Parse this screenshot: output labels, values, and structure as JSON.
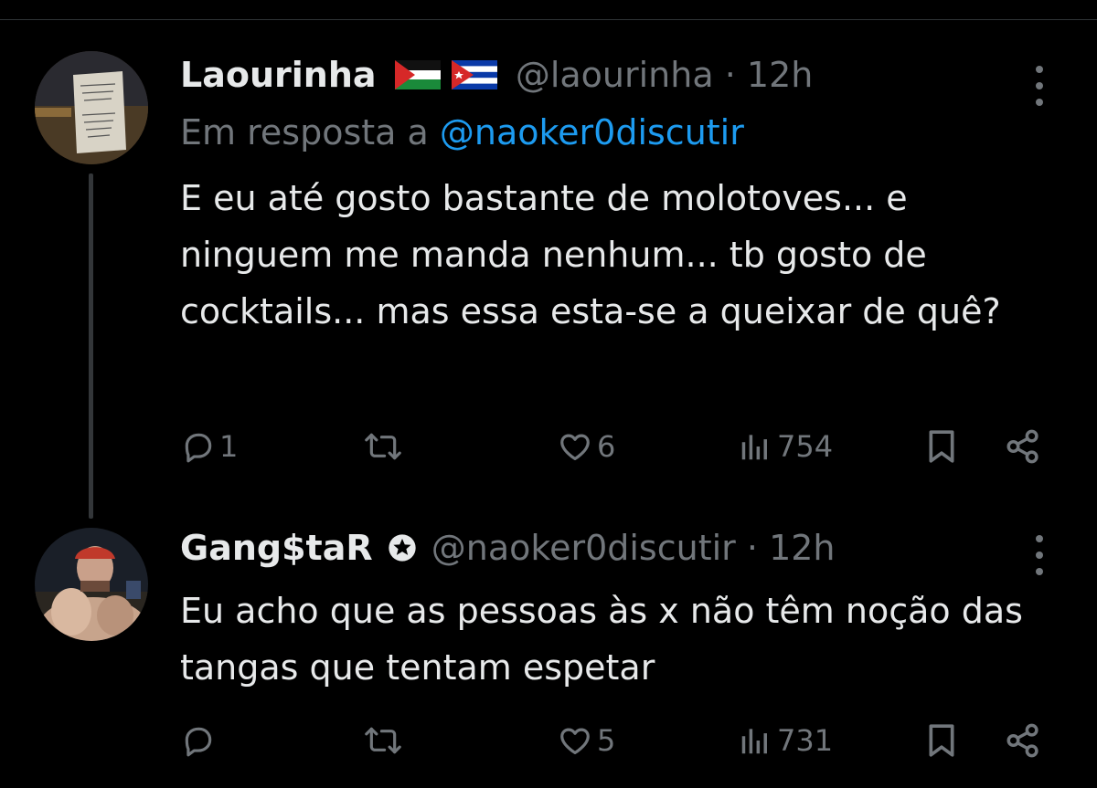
{
  "colors": {
    "background": "#000000",
    "text": "#e7e9ea",
    "muted": "#71767b",
    "link": "#1d9bf0",
    "divider": "#2f3336"
  },
  "tweets": [
    {
      "name": "Laourinha",
      "flags": [
        "palestine-flag-icon",
        "cuba-flag-icon"
      ],
      "handle": "@laourinha",
      "separator": "·",
      "time": "12h",
      "reply_prefix": "Em resposta a ",
      "reply_to": "@naoker0discutir",
      "text": "E eu até gosto bastante de molotoves... e ninguem me manda nenhum... tb gosto de cocktails... mas essa esta-se a queixar de quê?",
      "replies": "1",
      "reposts": "",
      "likes": "6",
      "views": "754"
    },
    {
      "name": "Gang$taR",
      "badge": "star-badge-icon",
      "handle": "@naoker0discutir",
      "separator": "·",
      "time": "12h",
      "text": "Eu acho que as pessoas às x não têm noção das tangas que tentam espetar",
      "replies": "",
      "reposts": "",
      "likes": "5",
      "views": "731"
    }
  ]
}
